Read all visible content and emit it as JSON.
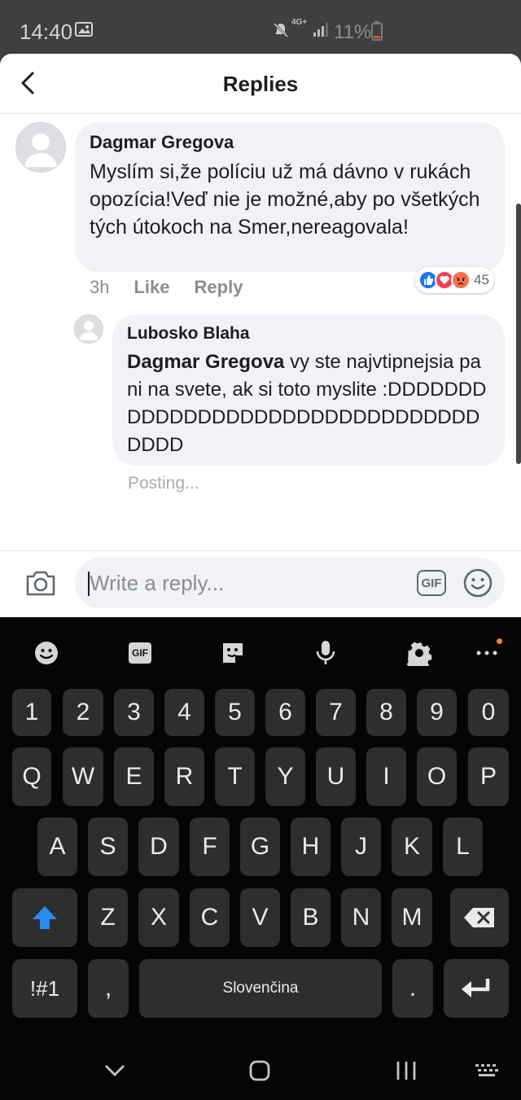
{
  "status_bar": {
    "time": "14:40",
    "network": "4G+",
    "battery": "11%"
  },
  "header": {
    "title": "Replies"
  },
  "comment": {
    "author": "Dagmar Gregova",
    "text": "Myslím si,že políciu už má dávno  v rukách opozícia!Veď nie je možné,aby po všetkých tých útokoch na Smer,nereagovala!",
    "time": "3h",
    "like_label": "Like",
    "reply_label": "Reply",
    "reaction_count": "45"
  },
  "reply": {
    "author": "Lubosko Blaha",
    "tagged": "Dagmar Gregova",
    "text": " vy ste najvtipnejsia pani na svete, ak si toto myslite :DDDDDDDDDDDDDDDDDDDDDDDDDDDDDDDDDDDD",
    "status": "Posting..."
  },
  "composer": {
    "placeholder": "Write a reply...",
    "gif_label": "GIF"
  },
  "keyboard": {
    "toolbar_gif": "GIF",
    "row_numbers": [
      "1",
      "2",
      "3",
      "4",
      "5",
      "6",
      "7",
      "8",
      "9",
      "0"
    ],
    "row_top": [
      "Q",
      "W",
      "E",
      "R",
      "T",
      "Y",
      "U",
      "I",
      "O",
      "P"
    ],
    "row_mid": [
      "A",
      "S",
      "D",
      "F",
      "G",
      "H",
      "J",
      "K",
      "L"
    ],
    "row_low": [
      "Z",
      "X",
      "C",
      "V",
      "B",
      "N",
      "M"
    ],
    "symbols_label": "!#1",
    "comma_label": ",",
    "space_label": "Slovenčina",
    "period_label": "."
  },
  "colors": {
    "accent": "#1877f2",
    "bubble": "#f0f2f5",
    "keyboard_bg": "#050505",
    "key_bg": "#2e2e2e"
  }
}
